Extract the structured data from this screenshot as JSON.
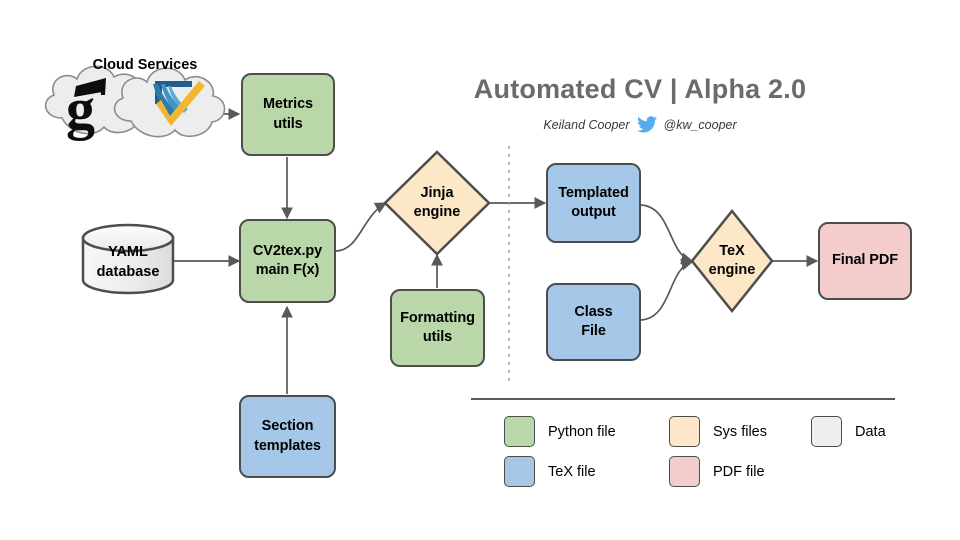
{
  "header": {
    "title": "Automated CV | Alpha 2.0",
    "author": "Keiland Cooper",
    "handle": "@kw_cooper",
    "twitter_icon": "twitter-bird-icon",
    "title_color": "#6b6b6b",
    "twitter_color": "#55acee"
  },
  "cloud": {
    "label": "Cloud Services",
    "services": [
      {
        "name": "google-scholar-icon",
        "glyph": "g"
      },
      {
        "name": "web-of-science-icon",
        "glyph": "checkmark-book"
      }
    ]
  },
  "nodes": {
    "metrics_utils": {
      "line1": "Metrics",
      "line2": "utils",
      "type": "python",
      "color": "#b9d7a8"
    },
    "yaml_database": {
      "line1": "YAML",
      "line2": "database",
      "type": "data",
      "color": "#efefef"
    },
    "cv2tex": {
      "line1": "CV2tex.py",
      "line2": "main F(x)",
      "type": "python",
      "color": "#b9d7a8"
    },
    "section_templates": {
      "line1": "Section",
      "line2": "templates",
      "type": "tex",
      "color": "#a5c8e8"
    },
    "formatting_utils": {
      "line1": "Formatting",
      "line2": "utils",
      "type": "python",
      "color": "#b9d7a8"
    },
    "jinja_engine": {
      "line1": "Jinja",
      "line2": "engine",
      "type": "sys",
      "color": "#fce8c7"
    },
    "templated_output": {
      "line1": "Templated",
      "line2": "output",
      "type": "tex",
      "color": "#a5c8e8"
    },
    "class_file": {
      "line1": "Class",
      "line2": "File",
      "type": "tex",
      "color": "#a5c8e8"
    },
    "tex_engine": {
      "line1": "TeX",
      "line2": "engine",
      "type": "sys",
      "color": "#fce8c7"
    },
    "final_pdf": {
      "line1": "Final PDF",
      "line2": "",
      "type": "pdf",
      "color": "#f4cccc"
    }
  },
  "legend": {
    "items": [
      {
        "label": "Python file",
        "color": "#b9d7a8"
      },
      {
        "label": "Sys files",
        "color": "#fce8c7"
      },
      {
        "label": "Data",
        "color": "#efefef"
      },
      {
        "label": "TeX file",
        "color": "#a5c8e8"
      },
      {
        "label": "PDF file",
        "color": "#f4cccc"
      }
    ]
  }
}
